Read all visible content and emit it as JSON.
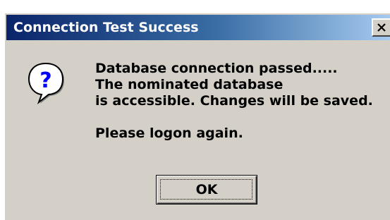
{
  "dialog": {
    "title": "Connection Test Success",
    "close_glyph": "✕",
    "icon": "question-icon",
    "message_lines": [
      "Database connection passed.....",
      "The nominated database",
      "is accessible. Changes will be saved."
    ],
    "prompt": "Please logon again.",
    "ok_label": "OK"
  },
  "colors": {
    "face": "#d4d0c8",
    "title_start": "#0a246a",
    "title_end": "#a6caf0"
  }
}
